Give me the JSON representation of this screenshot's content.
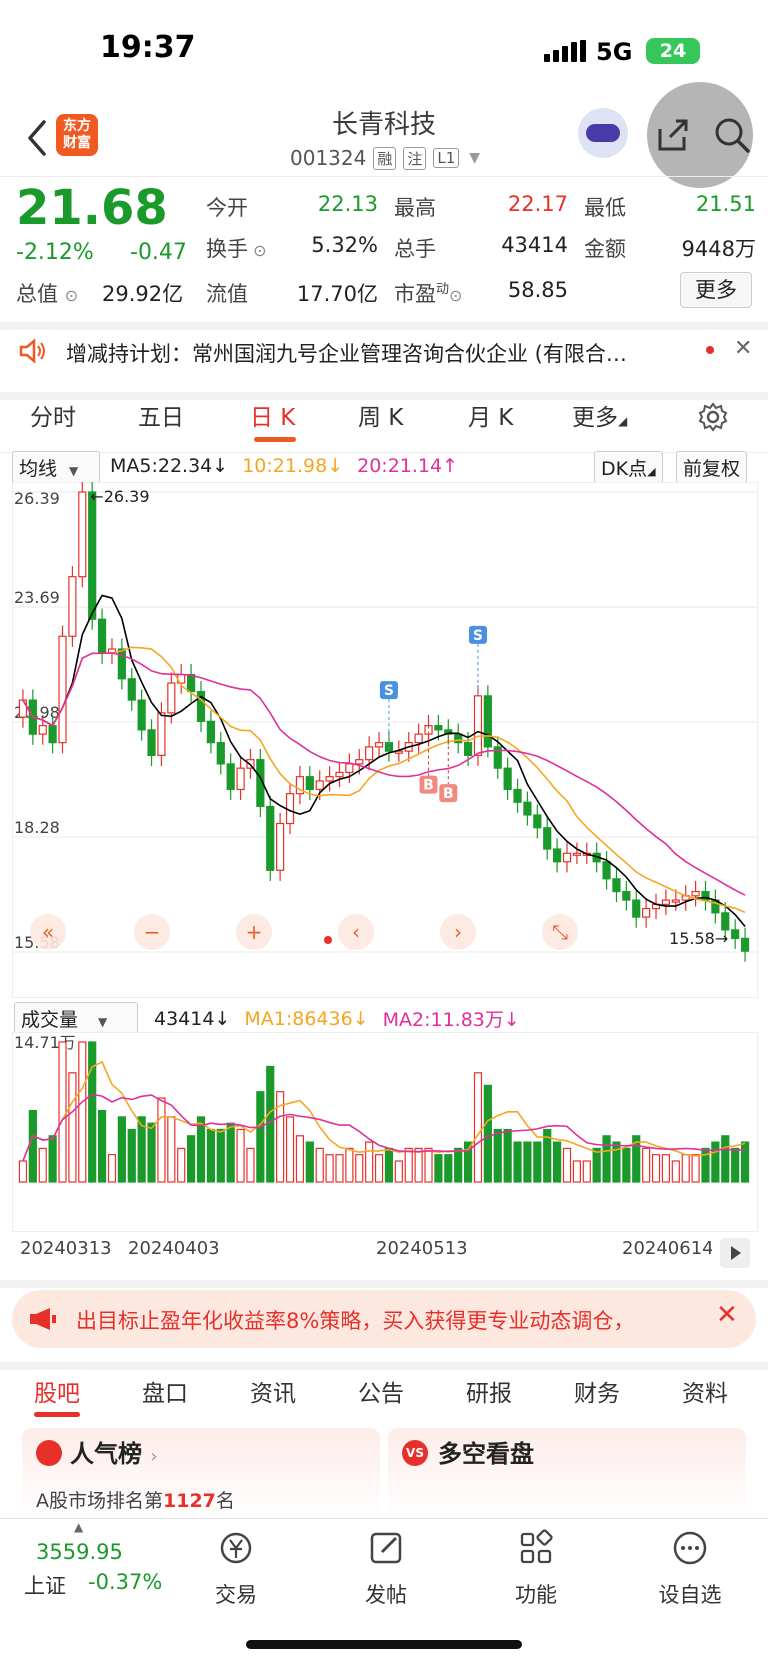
{
  "status": {
    "time": "19:37",
    "network": "5G",
    "battery": "24"
  },
  "header": {
    "logo": "东方财富",
    "name": "长青科技",
    "code": "001324",
    "tags": [
      "融",
      "注",
      "L1"
    ]
  },
  "quote": {
    "price": "21.68",
    "pct": "-2.12%",
    "chg": "-0.47",
    "open_label": "今开",
    "open": "22.13",
    "high_label": "最高",
    "high": "22.17",
    "low_label": "最低",
    "low": "21.51",
    "turnover_label": "换手",
    "turnover": "5.32%",
    "vol_label": "总手",
    "vol": "43414",
    "amount_label": "金额",
    "amount": "9448万",
    "mcap_label": "总值",
    "mcap": "29.92亿",
    "float_label": "流值",
    "float": "17.70亿",
    "pe_label": "市盈",
    "pe_sup": "动",
    "pe": "58.85",
    "more": "更多"
  },
  "notice": {
    "text": "增减持计划：常州国润九号企业管理咨询合伙企业 (有限合…"
  },
  "period_tabs": [
    "分时",
    "五日",
    "日 K",
    "周 K",
    "月 K",
    "更多"
  ],
  "ma_legend": {
    "select": "均线",
    "ma5": "MA5:22.34",
    "ma10": "10:21.98",
    "ma20": "20:21.14",
    "dk": "DK点",
    "fq": "前复权"
  },
  "vol_legend": {
    "select": "成交量",
    "vol": "43414",
    "ma1": "MA1:86436",
    "ma2": "MA2:11.83万"
  },
  "colors": {
    "up": "#e8302a",
    "down": "#1a9a2a",
    "ma5": "#000000",
    "ma10": "#f5a623",
    "ma20": "#e0309a"
  },
  "chart_data": {
    "type": "candlestick",
    "price_ticks": [
      "26.39",
      "23.69",
      "20.98",
      "18.28",
      "15.58"
    ],
    "price_range": [
      15.58,
      26.39
    ],
    "high_marker": "26.39",
    "low_marker": "15.58",
    "vol_max_label": "14.71万",
    "dates": [
      "20240313",
      "20240403",
      "20240513",
      "20240614"
    ],
    "signals": [
      "S",
      "S",
      "B",
      "B"
    ],
    "closes": [
      21.5,
      20.7,
      20.9,
      20.5,
      23.0,
      24.4,
      26.39,
      23.4,
      22.6,
      22.7,
      22.0,
      21.5,
      20.8,
      20.2,
      21.2,
      21.9,
      22.1,
      21.7,
      21.0,
      20.5,
      20.0,
      19.4,
      19.9,
      20.1,
      19.0,
      17.5,
      18.6,
      19.3,
      19.7,
      19.4,
      19.6,
      19.7,
      19.8,
      20.0,
      20.1,
      20.4,
      20.5,
      20.3,
      20.3,
      20.5,
      20.7,
      20.9,
      20.8,
      20.7,
      20.5,
      20.2,
      21.6,
      20.4,
      19.9,
      19.4,
      19.1,
      18.8,
      18.5,
      18.0,
      17.7,
      17.9,
      17.9,
      17.9,
      17.7,
      17.3,
      17.0,
      16.8,
      16.4,
      16.6,
      16.7,
      16.8,
      16.8,
      16.9,
      17.0,
      16.8,
      16.5,
      16.1,
      15.9,
      15.6
    ]
  },
  "ad": {
    "text": "出目标止盈年化收益率8%策略，买入获得更专业动态调仓，"
  },
  "info_tabs": [
    "股吧",
    "盘口",
    "资讯",
    "公告",
    "研报",
    "财务",
    "资料"
  ],
  "cards": {
    "hot_title": "人气榜",
    "hot_sub_pre": "A股市场排名第",
    "hot_rank": "1127",
    "hot_sub_post": "名",
    "ls_title": "多空看盘"
  },
  "bottom_nav": {
    "index_value": "3559.95",
    "index_name": "上证",
    "index_pct": "-0.37%",
    "items": [
      "交易",
      "发帖",
      "功能",
      "设自选"
    ]
  }
}
